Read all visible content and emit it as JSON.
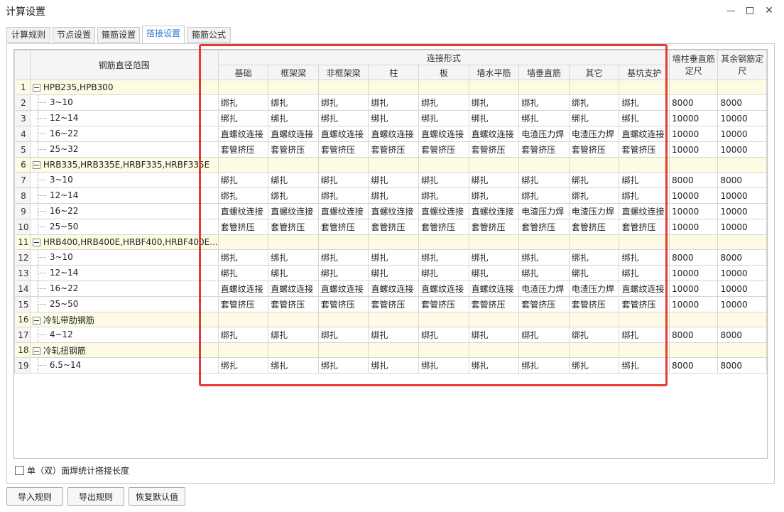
{
  "window": {
    "title": "计算设置"
  },
  "tabs": [
    {
      "label": "计算规则",
      "active": false
    },
    {
      "label": "节点设置",
      "active": false
    },
    {
      "label": "箍筋设置",
      "active": false
    },
    {
      "label": "搭接设置",
      "active": true
    },
    {
      "label": "箍筋公式",
      "active": false
    }
  ],
  "table": {
    "header": {
      "range": "钢筋直径范围",
      "connection_group": "连接形式",
      "wall_col_vertical": "墙柱垂直筋定尺",
      "other_bar": "其余钢筋定尺",
      "columns": [
        "基础",
        "框架梁",
        "非框架梁",
        "柱",
        "板",
        "墙水平筋",
        "墙垂直筋",
        "其它",
        "基坑支护"
      ]
    },
    "rows": [
      {
        "no": "1",
        "group": true,
        "label": "HPB235,HPB300"
      },
      {
        "no": "2",
        "group": false,
        "label": "3~10",
        "cells": [
          "绑扎",
          "绑扎",
          "绑扎",
          "绑扎",
          "绑扎",
          "绑扎",
          "绑扎",
          "绑扎",
          "绑扎"
        ],
        "wall": "8000",
        "other": "8000"
      },
      {
        "no": "3",
        "group": false,
        "label": "12~14",
        "cells": [
          "绑扎",
          "绑扎",
          "绑扎",
          "绑扎",
          "绑扎",
          "绑扎",
          "绑扎",
          "绑扎",
          "绑扎"
        ],
        "wall": "10000",
        "other": "10000"
      },
      {
        "no": "4",
        "group": false,
        "label": "16~22",
        "cells": [
          "直螺纹连接",
          "直螺纹连接",
          "直螺纹连接",
          "直螺纹连接",
          "直螺纹连接",
          "直螺纹连接",
          "电渣压力焊",
          "电渣压力焊",
          "直螺纹连接"
        ],
        "wall": "10000",
        "other": "10000"
      },
      {
        "no": "5",
        "group": false,
        "label": "25~32",
        "cells": [
          "套管挤压",
          "套管挤压",
          "套管挤压",
          "套管挤压",
          "套管挤压",
          "套管挤压",
          "套管挤压",
          "套管挤压",
          "套管挤压"
        ],
        "wall": "10000",
        "other": "10000"
      },
      {
        "no": "6",
        "group": true,
        "label": "HRB335,HRB335E,HRBF335,HRBF335E"
      },
      {
        "no": "7",
        "group": false,
        "label": "3~10",
        "cells": [
          "绑扎",
          "绑扎",
          "绑扎",
          "绑扎",
          "绑扎",
          "绑扎",
          "绑扎",
          "绑扎",
          "绑扎"
        ],
        "wall": "8000",
        "other": "8000"
      },
      {
        "no": "8",
        "group": false,
        "label": "12~14",
        "cells": [
          "绑扎",
          "绑扎",
          "绑扎",
          "绑扎",
          "绑扎",
          "绑扎",
          "绑扎",
          "绑扎",
          "绑扎"
        ],
        "wall": "10000",
        "other": "10000"
      },
      {
        "no": "9",
        "group": false,
        "label": "16~22",
        "cells": [
          "直螺纹连接",
          "直螺纹连接",
          "直螺纹连接",
          "直螺纹连接",
          "直螺纹连接",
          "直螺纹连接",
          "电渣压力焊",
          "电渣压力焊",
          "直螺纹连接"
        ],
        "wall": "10000",
        "other": "10000"
      },
      {
        "no": "10",
        "group": false,
        "label": "25~50",
        "cells": [
          "套管挤压",
          "套管挤压",
          "套管挤压",
          "套管挤压",
          "套管挤压",
          "套管挤压",
          "套管挤压",
          "套管挤压",
          "套管挤压"
        ],
        "wall": "10000",
        "other": "10000"
      },
      {
        "no": "11",
        "group": true,
        "label": "HRB400,HRB400E,HRBF400,HRBF400E..."
      },
      {
        "no": "12",
        "group": false,
        "label": "3~10",
        "cells": [
          "绑扎",
          "绑扎",
          "绑扎",
          "绑扎",
          "绑扎",
          "绑扎",
          "绑扎",
          "绑扎",
          "绑扎"
        ],
        "wall": "8000",
        "other": "8000"
      },
      {
        "no": "13",
        "group": false,
        "label": "12~14",
        "cells": [
          "绑扎",
          "绑扎",
          "绑扎",
          "绑扎",
          "绑扎",
          "绑扎",
          "绑扎",
          "绑扎",
          "绑扎"
        ],
        "wall": "10000",
        "other": "10000"
      },
      {
        "no": "14",
        "group": false,
        "label": "16~22",
        "cells": [
          "直螺纹连接",
          "直螺纹连接",
          "直螺纹连接",
          "直螺纹连接",
          "直螺纹连接",
          "直螺纹连接",
          "电渣压力焊",
          "电渣压力焊",
          "直螺纹连接"
        ],
        "wall": "10000",
        "other": "10000"
      },
      {
        "no": "15",
        "group": false,
        "label": "25~50",
        "cells": [
          "套管挤压",
          "套管挤压",
          "套管挤压",
          "套管挤压",
          "套管挤压",
          "套管挤压",
          "套管挤压",
          "套管挤压",
          "套管挤压"
        ],
        "wall": "10000",
        "other": "10000"
      },
      {
        "no": "16",
        "group": true,
        "label": "冷轧带肋钢筋"
      },
      {
        "no": "17",
        "group": false,
        "label": "4~12",
        "cells": [
          "绑扎",
          "绑扎",
          "绑扎",
          "绑扎",
          "绑扎",
          "绑扎",
          "绑扎",
          "绑扎",
          "绑扎"
        ],
        "wall": "8000",
        "other": "8000"
      },
      {
        "no": "18",
        "group": true,
        "label": "冷轧扭钢筋"
      },
      {
        "no": "19",
        "group": false,
        "label": "6.5~14",
        "cells": [
          "绑扎",
          "绑扎",
          "绑扎",
          "绑扎",
          "绑扎",
          "绑扎",
          "绑扎",
          "绑扎",
          "绑扎"
        ],
        "wall": "8000",
        "other": "8000"
      }
    ]
  },
  "checkbox": {
    "label": "单（双）面焊统计搭接长度",
    "checked": false
  },
  "buttons": {
    "import": "导入规则",
    "export": "导出规则",
    "restore": "恢复默认值"
  },
  "colors": {
    "highlight": "#e53935",
    "active_tab": "#2a7ad2",
    "group_row": "#fdfbe4"
  }
}
